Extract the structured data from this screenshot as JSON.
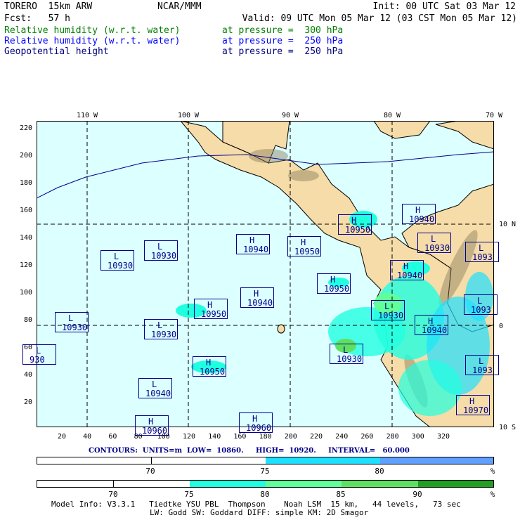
{
  "header": {
    "model": "TORERO  15km ARW",
    "org": "NCAR/MMM",
    "init": "Init: 00 UTC Sat 03 Mar 12",
    "fcst": "Fcst:   57 h",
    "valid": "Valid: 09 UTC Mon 05 Mar 12 (03 CST Mon 05 Mar 12)",
    "fields": [
      {
        "name": "Relative humidity (w.r.t. water)",
        "level": "at pressure =  300 hPa"
      },
      {
        "name": "Relative humidity (w.r.t. water)",
        "level": "at pressure =  250 hPa"
      },
      {
        "name": "Geopotential height",
        "level": "at pressure =  250 hPa"
      }
    ]
  },
  "axes": {
    "lon_labels": [
      "110 W",
      "100 W",
      "90 W",
      "80 W",
      "70 W"
    ],
    "lat_labels": [
      "10 N",
      "0",
      "10 S"
    ],
    "y_ticks": [
      "220",
      "200",
      "180",
      "160",
      "140",
      "120",
      "100",
      "80",
      "60",
      "40",
      "20"
    ],
    "x_ticks": [
      "20",
      "40",
      "60",
      "80",
      "100",
      "120",
      "140",
      "160",
      "180",
      "200",
      "220",
      "240",
      "260",
      "280",
      "300",
      "320"
    ]
  },
  "centers": [
    {
      "k": "L",
      "v": "10930"
    },
    {
      "k": "L",
      "v": "10930"
    },
    {
      "k": "H",
      "v": "10940"
    },
    {
      "k": "H",
      "v": "10950"
    },
    {
      "k": "H",
      "v": "10940"
    },
    {
      "k": "H",
      "v": "10950"
    },
    {
      "k": "L",
      "v": "10930"
    },
    {
      "k": "L",
      "v": "1093"
    },
    {
      "k": "H",
      "v": "10940"
    },
    {
      "k": "H",
      "v": "10950"
    },
    {
      "k": "H",
      "v": "10940"
    },
    {
      "k": "H",
      "v": "10950"
    },
    {
      "k": "L",
      "v": "10930"
    },
    {
      "k": "L",
      "v": "1093"
    },
    {
      "k": "H",
      "v": "10940"
    },
    {
      "k": "L",
      "v": "10930"
    },
    {
      "k": "L",
      "v": "10930"
    },
    {
      "k": "L",
      "v": "930"
    },
    {
      "k": "L",
      "v": "10930"
    },
    {
      "k": "H",
      "v": "10950"
    },
    {
      "k": "L",
      "v": "1093"
    },
    {
      "k": "L",
      "v": "10940"
    },
    {
      "k": "H",
      "v": "10970"
    },
    {
      "k": "H",
      "v": "10960"
    },
    {
      "k": "H",
      "v": "10960"
    }
  ],
  "contours": "CONTOURS:  UNITS=m  LOW=  10860.     HIGH=  10920.     INTERVAL=   60.000",
  "colorbar_250": {
    "labels": [
      "70",
      "75",
      "80",
      "%"
    ],
    "colors": [
      "#ffffff",
      "#ffffff",
      "#20e0ff",
      "#60a0ff"
    ]
  },
  "colorbar_300": {
    "labels": [
      "70",
      "75",
      "80",
      "85",
      "90",
      "%"
    ],
    "colors": [
      "#ffffff",
      "#ffffff",
      "#20ffe0",
      "#60ff9a",
      "#60e060",
      "#20a020"
    ]
  },
  "footer": {
    "line1": "Model Info: V3.3.1   Tiedtke YSU PBL  Thompson    Noah LSM  15 km,   44 levels,   73 sec",
    "line2": "LW: Godd SW: Goddard DIFF: simple KM: 2D Smagor"
  },
  "colors": {
    "ocean": "#dcffff",
    "land": "#f5dca8",
    "contour": "#00008b"
  }
}
